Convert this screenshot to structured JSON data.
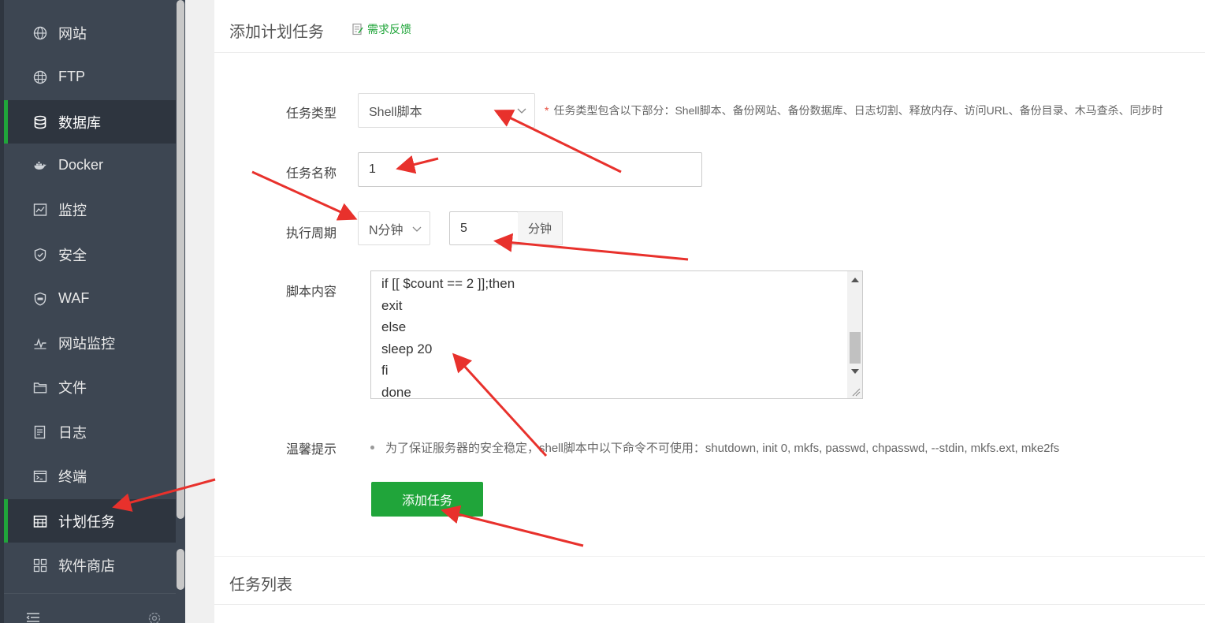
{
  "sidebar": {
    "items": [
      {
        "label": "网站",
        "icon": "globe-icon"
      },
      {
        "label": "FTP",
        "icon": "globe-grid-icon"
      },
      {
        "label": "数据库",
        "icon": "database-icon"
      },
      {
        "label": "Docker",
        "icon": "docker-icon"
      },
      {
        "label": "监控",
        "icon": "monitor-chart-icon"
      },
      {
        "label": "安全",
        "icon": "shield-icon"
      },
      {
        "label": "WAF",
        "icon": "waf-shield-icon"
      },
      {
        "label": "网站监控",
        "icon": "pulse-icon"
      },
      {
        "label": "文件",
        "icon": "folder-icon"
      },
      {
        "label": "日志",
        "icon": "log-icon"
      },
      {
        "label": "终端",
        "icon": "terminal-icon"
      },
      {
        "label": "计划任务",
        "icon": "calendar-icon"
      },
      {
        "label": "软件商店",
        "icon": "apps-grid-icon"
      }
    ],
    "active_items": [
      "数据库",
      "计划任务"
    ]
  },
  "header": {
    "title": "添加计划任务",
    "feedback": "需求反馈"
  },
  "form": {
    "task_type_label": "任务类型",
    "task_type_value": "Shell脚本",
    "task_type_hint": "任务类型包含以下部分：Shell脚本、备份网站、备份数据库、日志切割、释放内存、访问URL、备份目录、木马查杀、同步时",
    "task_name_label": "任务名称",
    "task_name_value": "1",
    "period_label": "执行周期",
    "period_type": "N分钟",
    "period_value": "5",
    "period_unit": "分钟",
    "script_label": "脚本内容",
    "script_lines": {
      "l1": "if [[ $count == 2 ]];then",
      "l2": "exit",
      "l3": "else",
      "l4": "sleep 20",
      "l5": "fi",
      "l6": "done"
    },
    "tip_label": "温馨提示",
    "tip_text": "为了保证服务器的安全稳定，shell脚本中以下命令不可使用：shutdown, init 0, mkfs, passwd, chpasswd, --stdin, mkfs.ext, mke2fs",
    "submit_label": "添加任务"
  },
  "task_list": {
    "title": "任务列表"
  },
  "colors": {
    "sidebar_bg": "#3d4652",
    "accent_green": "#20a53a",
    "annotation_red": "#e8312c"
  }
}
